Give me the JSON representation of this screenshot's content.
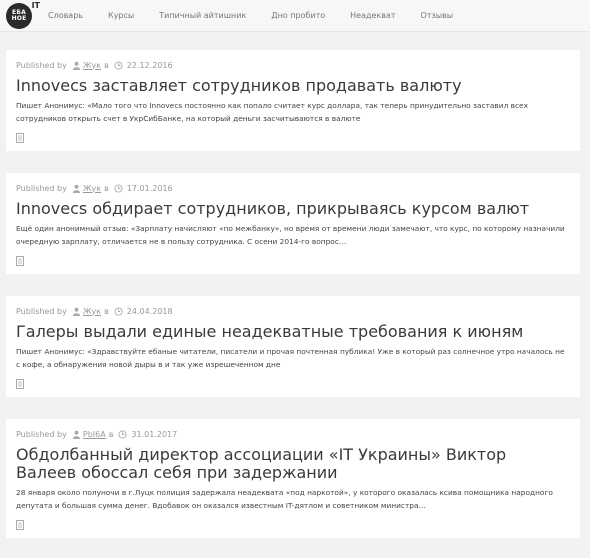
{
  "logo": {
    "text": "ЕБА\nНОЕ",
    "sup": "IT"
  },
  "nav": {
    "items": [
      {
        "label": "Словарь"
      },
      {
        "label": "Курсы"
      },
      {
        "label": "Типичный айтишник"
      },
      {
        "label": "Дно пробито"
      },
      {
        "label": "Неадекват"
      },
      {
        "label": "Отзывы"
      }
    ]
  },
  "posts": [
    {
      "published_by": "Published by",
      "author": "Жук",
      "in": "в",
      "date": "22.12.2016",
      "title": "Innovecs заставляет сотрудников продавать валюту",
      "excerpt": "Пишет Анонимус: «Мало того что Innovecs постоянно как попало считает курс доллара, так теперь принудительно заставил всех сотрудников открыть счет в УкрСибБанке, на который деньги засчитываются в валюте"
    },
    {
      "published_by": "Published by",
      "author": "Жук",
      "in": "в",
      "date": "17.01.2016",
      "title": "Innovecs обдирает сотрудников, прикрываясь курсом валют",
      "excerpt": "Ещё один анонимный отзыв: «Зарплату начисляют «по межбанку», но время от времени люди замечают, что курс, по которому назначили очередную зарплату, отличается не в пользу сотрудника. С осени 2014-го вопрос…"
    },
    {
      "published_by": "Published by",
      "author": "Жук",
      "in": "в",
      "date": "24.04.2018",
      "title": "Галеры выдали единые неадекватные требования к июням",
      "excerpt": "Пишет Анонимус: «Здравствуйте ебаные читатели, писатели и прочая почтенная публика! Уже в который раз солнечное утро началось не с кофе, а обнаружения новой дыры в и так уже изрешеченном дне"
    },
    {
      "published_by": "Published by",
      "author": "PbI6A",
      "in": "в",
      "date": "31.01.2017",
      "title": "Обдолбанный директор ассоциации «IT Украины» Виктор Валеев обоссал себя при задержании",
      "excerpt": "28 января около полуночи в г.Луцк полиция задержала неадеквата «под наркотой», у которого оказалась ксива помощника народного депутата и большая сумма денег. Вдобавок он оказался известным IT-дятлом и советником министра…"
    }
  ]
}
